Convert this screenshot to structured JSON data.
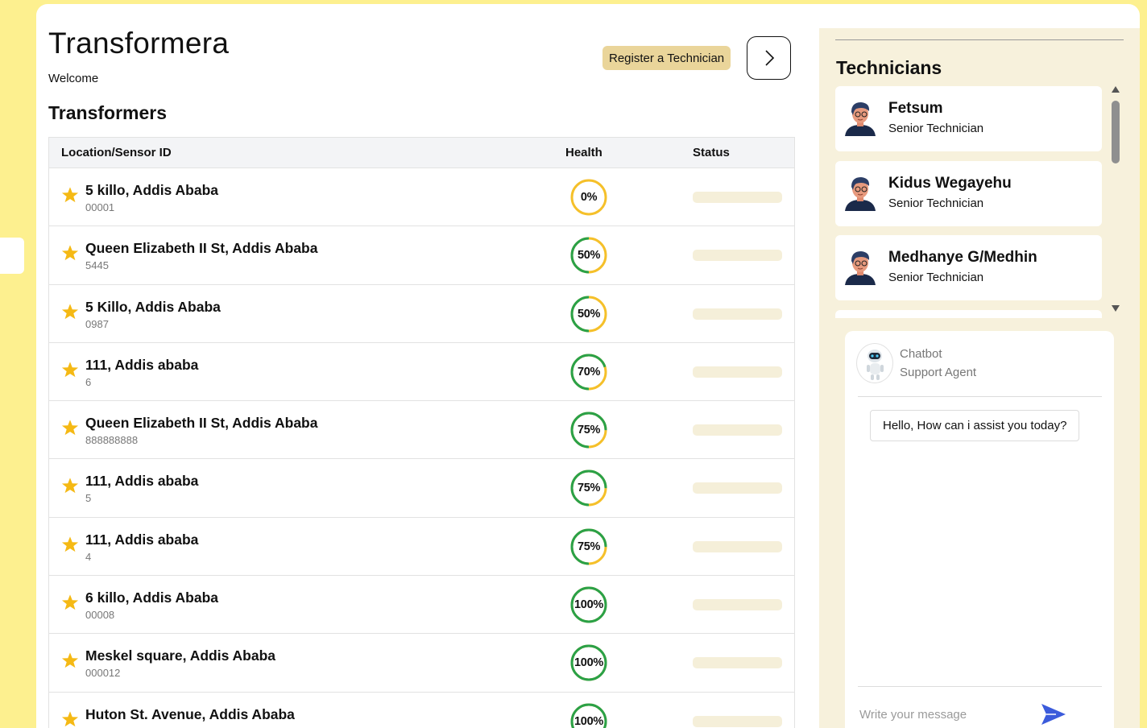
{
  "app": {
    "title": "Transformera",
    "welcome": "Welcome",
    "register_label": "Register a Technician",
    "next_icon": "chevron-right-icon"
  },
  "transformers": {
    "title": "Transformers",
    "columns": [
      "Location/Sensor ID",
      "Health",
      "Status"
    ],
    "rows": [
      {
        "location": "5 killo, Addis Ababa",
        "sensor_id": "00001",
        "health": "0%",
        "health_value": 0
      },
      {
        "location": "Queen Elizabeth II St, Addis Ababa",
        "sensor_id": "5445",
        "health": "50%",
        "health_value": 50
      },
      {
        "location": "5 Killo, Addis Ababa",
        "sensor_id": "0987",
        "health": "50%",
        "health_value": 50
      },
      {
        "location": "111, Addis ababa",
        "sensor_id": "6",
        "health": "70%",
        "health_value": 70
      },
      {
        "location": "Queen Elizabeth II St, Addis Ababa",
        "sensor_id": "888888888",
        "health": "75%",
        "health_value": 75
      },
      {
        "location": "111, Addis ababa",
        "sensor_id": "5",
        "health": "75%",
        "health_value": 75
      },
      {
        "location": "111, Addis ababa",
        "sensor_id": "4",
        "health": "75%",
        "health_value": 75
      },
      {
        "location": "6 killo, Addis Ababa",
        "sensor_id": "00008",
        "health": "100%",
        "health_value": 100
      },
      {
        "location": "Meskel square, Addis Ababa",
        "sensor_id": "000012",
        "health": "100%",
        "health_value": 100
      },
      {
        "location": "Huton St. Avenue, Addis Ababa",
        "sensor_id": "",
        "health": "100%",
        "health_value": 100
      }
    ],
    "colors": {
      "good": "#2aa148",
      "warn": "#f5c02a",
      "star": "#f5b914",
      "status_bar": "#f5efd9"
    }
  },
  "technicians": {
    "title": "Technicians",
    "items": [
      {
        "name": "Fetsum",
        "role": "Senior Technician"
      },
      {
        "name": "Kidus Wegayehu",
        "role": "Senior Technician"
      },
      {
        "name": "Medhanye G/Medhin",
        "role": "Senior Technician"
      }
    ]
  },
  "chat": {
    "bot_name": "Chatbot",
    "bot_role": "Support Agent",
    "greeting": "Hello, How can i assist you today?",
    "placeholder": "Write your message",
    "send_icon": "send-icon",
    "accent": "#3b5bdb"
  }
}
